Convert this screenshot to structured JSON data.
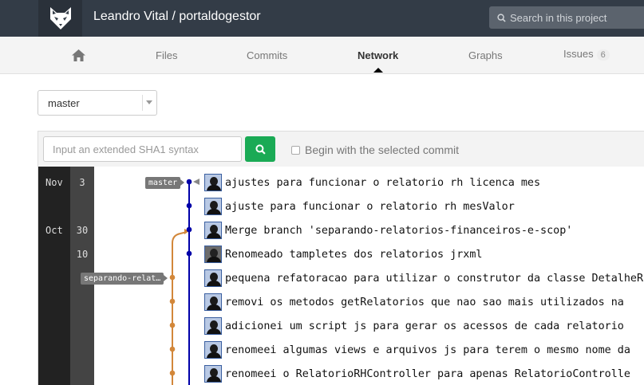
{
  "header": {
    "title": "Leandro Vital / portaldogestor",
    "search_placeholder": "Search in this project"
  },
  "nav": {
    "home_icon": "home-icon",
    "files": "Files",
    "commits": "Commits",
    "network": "Network",
    "graphs": "Graphs",
    "issues": "Issues",
    "issues_count": "6",
    "active": "Network"
  },
  "branch_select": {
    "value": "master"
  },
  "filter": {
    "sha_placeholder": "Input an extended SHA1 syntax",
    "begin_label": "Begin with the selected commit",
    "begin_checked": false
  },
  "network": {
    "dates": [
      {
        "month": "Nov",
        "day": "3"
      },
      {
        "month": "",
        "day": ""
      },
      {
        "month": "Oct",
        "day": "30"
      },
      {
        "month": "",
        "day": "10"
      }
    ],
    "labels": {
      "master": "master",
      "branch": "separando-relat…"
    },
    "colors": {
      "master": "#0000a8",
      "branch": "#d2873a"
    },
    "commits": [
      {
        "message": "ajustes para funcionar o relatorio rh licenca mes",
        "avatar": "person"
      },
      {
        "message": "ajuste para funcionar o relatorio rh mesValor",
        "avatar": "person"
      },
      {
        "message": "Merge branch 'separando-relatorios-financeiros-e-scop'",
        "avatar": "person"
      },
      {
        "message": "Renomeado tampletes dos relatorios jrxml",
        "avatar": "alt"
      },
      {
        "message": "pequena refatoracao para utilizar o construtor da classe DetalheR",
        "avatar": "person"
      },
      {
        "message": "removi os metodos getRelatorios que nao sao mais utilizados na",
        "avatar": "person"
      },
      {
        "message": "adicionei um script js para gerar os acessos de cada relatorio",
        "avatar": "person"
      },
      {
        "message": "renomeei algumas views e arquivos js para terem o mesmo nome da",
        "avatar": "person"
      },
      {
        "message": "renomeei o RelatorioRHController para apenas RelatorioControlle",
        "avatar": "person"
      }
    ]
  }
}
